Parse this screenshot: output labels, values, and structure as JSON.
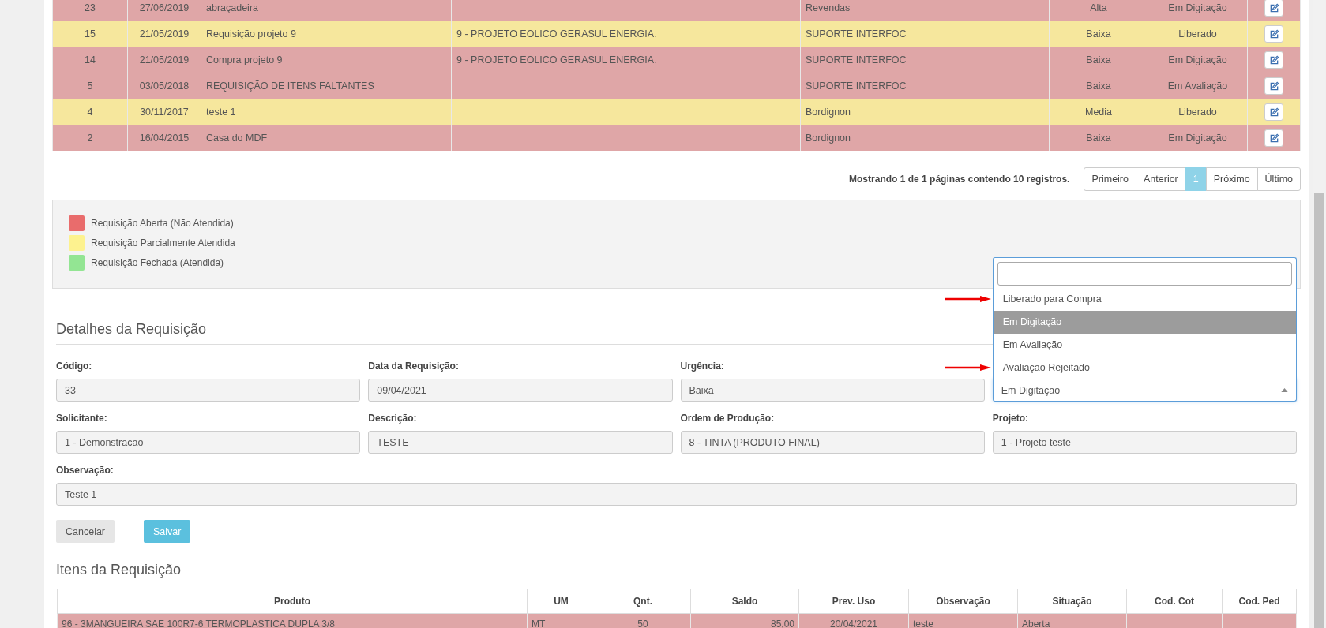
{
  "requisitions": {
    "rows": [
      {
        "number": "23",
        "date": "27/06/2019",
        "description": "abraçadeira",
        "requester": "Revendas",
        "urgency": "Alta",
        "status": "Em Digitação",
        "color": "#dfa6a7"
      },
      {
        "number": "15",
        "date": "21/05/2019",
        "description": "Requisição projeto 9",
        "project": "9 - PROJETO EOLICO GERASUL ENERGIA.",
        "requester": "SUPORTE INTERFOC",
        "urgency": "Baixa",
        "status": "Liberado",
        "color": "#f6e79d"
      },
      {
        "number": "14",
        "date": "21/05/2019",
        "description": "Compra projeto 9",
        "project": "9 - PROJETO EOLICO GERASUL ENERGIA.",
        "requester": "SUPORTE INTERFOC",
        "urgency": "Baixa",
        "status": "Em Digitação",
        "color": "#dfa6a7"
      },
      {
        "number": "5",
        "date": "03/05/2018",
        "description": "REQUISIÇÃO DE ITENS FALTANTES",
        "requester": "SUPORTE INTERFOC",
        "urgency": "Baixa",
        "status": "Em Avaliação",
        "color": "#dfa6a7"
      },
      {
        "number": "4",
        "date": "30/11/2017",
        "description": "teste 1",
        "requester": "Bordignon",
        "urgency": "Media",
        "status": "Liberado",
        "color": "#f6e79d"
      },
      {
        "number": "2",
        "date": "16/04/2015",
        "description": "Casa do MDF",
        "requester": "Bordignon",
        "urgency": "Baixa",
        "status": "Em Digitação",
        "color": "#dfa6a7"
      }
    ]
  },
  "pagination": {
    "summary": "Mostrando 1 de 1 páginas contendo 10 registros.",
    "buttons": [
      {
        "label": "Primeiro",
        "selected": false
      },
      {
        "label": "Anterior",
        "selected": false
      },
      {
        "label": "1",
        "selected": true
      },
      {
        "label": "Próximo",
        "selected": false
      },
      {
        "label": "Último",
        "selected": false
      }
    ]
  },
  "legend": [
    {
      "label": "Requisição Aberta (Não Atendida)",
      "color": "#e96c6c"
    },
    {
      "label": "Requisição Parcialmente Atendida",
      "color": "#fdf28f"
    },
    {
      "label": "Requisição Fechada (Atendida)",
      "color": "#93e593"
    }
  ],
  "details": {
    "title": "Detalhes da Requisição",
    "fields": [
      {
        "kind": "text",
        "label": "Código:",
        "value": "33"
      },
      {
        "kind": "text",
        "label": "Data da Requisição:",
        "value": "09/04/2021"
      },
      {
        "kind": "text",
        "label": "Urgência:",
        "value": "Baixa"
      },
      {
        "kind": "select",
        "value": "Em Digitação",
        "expanded": true,
        "options": [
          {
            "label": "Liberado para Compra",
            "selected": false,
            "marked": true
          },
          {
            "label": "Em Digitação",
            "selected": true,
            "marked": false
          },
          {
            "label": "Em Avaliação",
            "selected": false,
            "marked": false
          },
          {
            "label": "Avaliação Rejeitado",
            "selected": false,
            "marked": true
          }
        ]
      },
      {
        "kind": "text",
        "label": "Solicitante:",
        "value": "1 - Demonstracao"
      },
      {
        "kind": "text",
        "label": "Descrição:",
        "value": "TESTE"
      },
      {
        "kind": "text",
        "label": "Ordem de Produção:",
        "value": "8 - TINTA (PRODUTO FINAL)"
      },
      {
        "kind": "text",
        "label": "Projeto:",
        "value": "1 - Projeto teste"
      },
      {
        "kind": "wide",
        "label": "Observação:",
        "value": "Teste 1"
      }
    ],
    "buttons": [
      {
        "label": "Cancelar",
        "kind": "default"
      },
      {
        "label": "Salvar",
        "kind": "primary"
      }
    ]
  },
  "items": {
    "title": "Itens da Requisição",
    "columns": [
      "Produto",
      "UM",
      "Qnt.",
      "Saldo",
      "Prev. Uso",
      "Observação",
      "Situação",
      "Cod. Cot",
      "Cod. Ped"
    ],
    "rows": [
      {
        "cells": [
          "96 - 3MANGUEIRA SAE 100R7-6 TERMOPLASTICA DUPLA 3/8",
          "MT",
          "50",
          "85,00",
          "20/04/2021",
          "teste",
          "Aberta"
        ],
        "color": "#dfa6a7"
      }
    ]
  }
}
